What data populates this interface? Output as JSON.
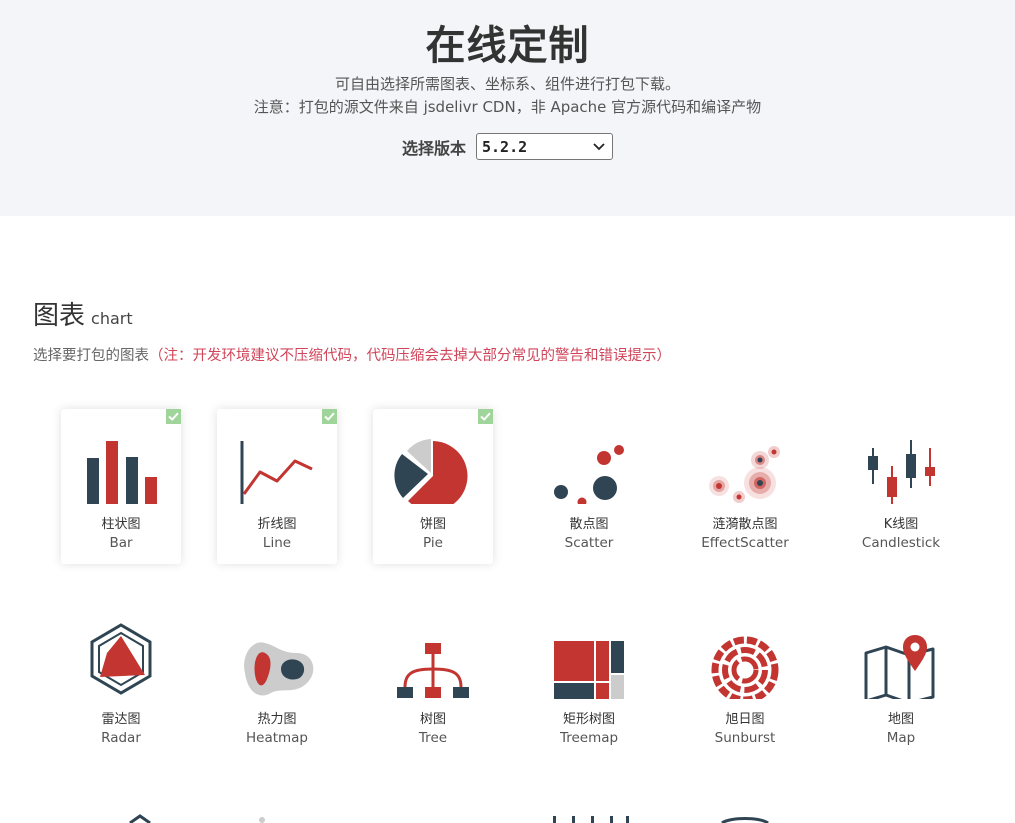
{
  "header": {
    "title": "在线定制",
    "description_line1": "可自由选择所需图表、坐标系、组件进行打包下载。",
    "description_line2": "注意：打包的源文件来自 jsdelivr CDN，非 Apache 官方源代码和编译产物",
    "version_label": "选择版本",
    "version_value": "5.2.2"
  },
  "section": {
    "title_zh": "图表",
    "title_en": "chart",
    "hint_normal": "选择要打包的图表",
    "hint_warn": "（注：开发环境建议不压缩代码，代码压缩会去掉大部分常见的警告和错误提示）"
  },
  "charts": [
    {
      "zh": "柱状图",
      "en": "Bar",
      "selected": true,
      "icon": "bar-chart-icon"
    },
    {
      "zh": "折线图",
      "en": "Line",
      "selected": true,
      "icon": "line-chart-icon"
    },
    {
      "zh": "饼图",
      "en": "Pie",
      "selected": true,
      "icon": "pie-chart-icon"
    },
    {
      "zh": "散点图",
      "en": "Scatter",
      "selected": false,
      "icon": "scatter-chart-icon"
    },
    {
      "zh": "涟漪散点图",
      "en": "EffectScatter",
      "selected": false,
      "icon": "effect-scatter-icon"
    },
    {
      "zh": "K线图",
      "en": "Candlestick",
      "selected": false,
      "icon": "candlestick-icon"
    },
    {
      "zh": "雷达图",
      "en": "Radar",
      "selected": false,
      "icon": "radar-chart-icon"
    },
    {
      "zh": "热力图",
      "en": "Heatmap",
      "selected": false,
      "icon": "heatmap-icon"
    },
    {
      "zh": "树图",
      "en": "Tree",
      "selected": false,
      "icon": "tree-chart-icon"
    },
    {
      "zh": "矩形树图",
      "en": "Treemap",
      "selected": false,
      "icon": "treemap-icon"
    },
    {
      "zh": "旭日图",
      "en": "Sunburst",
      "selected": false,
      "icon": "sunburst-icon"
    },
    {
      "zh": "地图",
      "en": "Map",
      "selected": false,
      "icon": "map-icon"
    }
  ],
  "colors": {
    "red": "#c23531",
    "navy": "#2f4554",
    "gray": "#cccccc",
    "check": "#9fd49a",
    "header_bg": "#f3f5f9"
  }
}
